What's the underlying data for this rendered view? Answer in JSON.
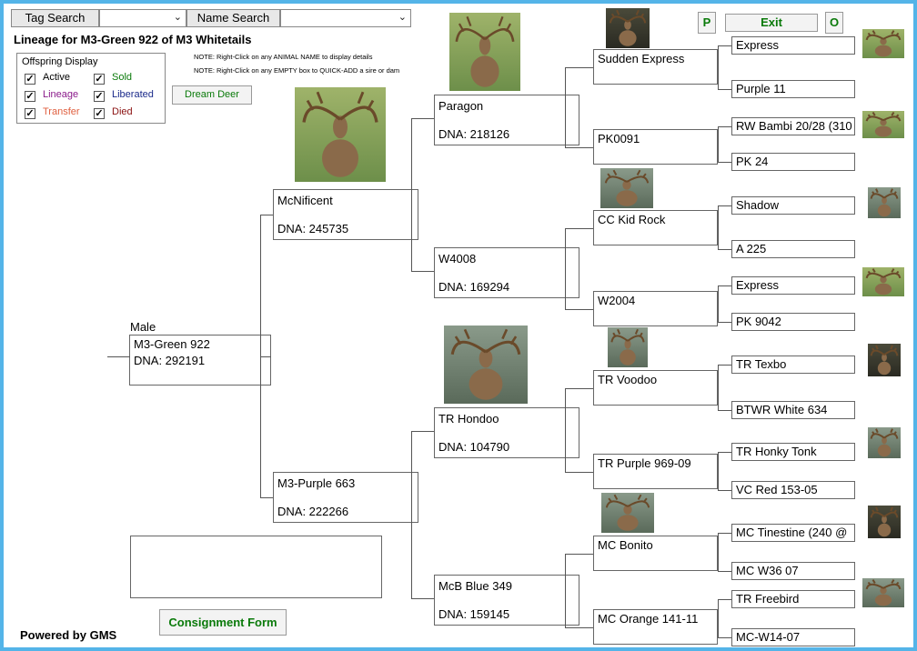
{
  "toolbar": {
    "tag_search_label": "Tag Search",
    "tag_search_value": "",
    "name_search_label": "Name Search",
    "name_search_value": "",
    "p_label": "P",
    "exit_label": "Exit",
    "o_label": "O"
  },
  "header": {
    "title": "Lineage for M3-Green 922 of M3 Whitetails",
    "note1": "NOTE: Right-Click on any ANIMAL NAME to display details",
    "note2": "NOTE: Right-Click on any EMPTY box to QUICK-ADD a sire or dam"
  },
  "offspring_display": {
    "title": "Offspring Display",
    "items": [
      {
        "label": "Active",
        "checked": "✓",
        "color": "#000000"
      },
      {
        "label": "Sold",
        "checked": "✓",
        "color": "#0a7a0a"
      },
      {
        "label": "Lineage",
        "checked": "✓",
        "color": "#8a1a8a"
      },
      {
        "label": "Liberated",
        "checked": "✓",
        "color": "#1a2a8a"
      },
      {
        "label": "Transfer",
        "checked": "✓",
        "color": "#e06040"
      },
      {
        "label": "Died",
        "checked": "✓",
        "color": "#8a1010"
      }
    ]
  },
  "dream_deer_label": "Dream Deer",
  "consignment_label": "Consignment Form",
  "powered_by": "Powered by GMS",
  "subject": {
    "sex_label": "Male",
    "name": "M3-Green 922",
    "dna": "DNA: 292191"
  },
  "gen1": [
    {
      "name": "McNificent",
      "dna": "DNA: 245735"
    },
    {
      "name": "M3-Purple 663",
      "dna": "DNA: 222266"
    }
  ],
  "gen2": [
    {
      "name": "Paragon",
      "dna": "DNA: 218126"
    },
    {
      "name": "W4008",
      "dna": "DNA: 169294"
    },
    {
      "name": "TR Hondoo",
      "dna": "DNA:  104790"
    },
    {
      "name": "McB Blue 349",
      "dna": "DNA: 159145"
    }
  ],
  "gen3": [
    {
      "name": "Sudden Express"
    },
    {
      "name": "PK0091"
    },
    {
      "name": "CC Kid Rock"
    },
    {
      "name": "W2004"
    },
    {
      "name": "TR Voodoo"
    },
    {
      "name": "TR Purple 969-09"
    },
    {
      "name": "MC Bonito"
    },
    {
      "name": "MC Orange 141-11"
    }
  ],
  "gen4": [
    {
      "name": "Express"
    },
    {
      "name": "Purple 11"
    },
    {
      "name": "RW Bambi 20/28 (310"
    },
    {
      "name": "PK 24"
    },
    {
      "name": "Shadow"
    },
    {
      "name": "A 225"
    },
    {
      "name": "Express"
    },
    {
      "name": "PK 9042"
    },
    {
      "name": "TR Texbo"
    },
    {
      "name": "BTWR White 634"
    },
    {
      "name": "TR Honky Tonk"
    },
    {
      "name": "VC Red 153-05"
    },
    {
      "name": "MC Tinestine (240 @"
    },
    {
      "name": "MC W36 07"
    },
    {
      "name": "TR Freebird"
    },
    {
      "name": "MC-W14-07"
    }
  ]
}
